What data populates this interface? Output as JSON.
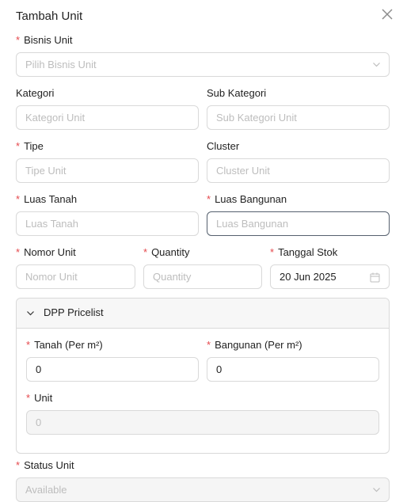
{
  "modal": {
    "title": "Tambah Unit"
  },
  "fields": {
    "bisnis_unit": {
      "label": "Bisnis Unit",
      "placeholder": "Pilih Bisnis Unit"
    },
    "kategori": {
      "label": "Kategori",
      "placeholder": "Kategori Unit"
    },
    "sub_kategori": {
      "label": "Sub Kategori",
      "placeholder": "Sub Kategori Unit"
    },
    "tipe": {
      "label": "Tipe",
      "placeholder": "Tipe Unit"
    },
    "cluster": {
      "label": "Cluster",
      "placeholder": "Cluster Unit"
    },
    "luas_tanah": {
      "label": "Luas Tanah",
      "placeholder": "Luas Tanah"
    },
    "luas_bangunan": {
      "label": "Luas Bangunan",
      "placeholder": "Luas Bangunan"
    },
    "nomor_unit": {
      "label": "Nomor Unit",
      "placeholder": "Nomor Unit"
    },
    "quantity": {
      "label": "Quantity",
      "placeholder": "Quantity"
    },
    "tanggal_stok": {
      "label": "Tanggal Stok",
      "value": "20 Jun 2025"
    },
    "status_unit": {
      "label": "Status Unit",
      "value": "Available"
    }
  },
  "dpp_panel": {
    "title": "DPP Pricelist",
    "tanah": {
      "label": "Tanah (Per m²)",
      "value": "0"
    },
    "bangunan": {
      "label": "Bangunan (Per m²)",
      "value": "0"
    },
    "unit": {
      "label": "Unit",
      "value": "0"
    }
  },
  "colors": {
    "required": "#e5484d",
    "border": "#d9d9d9",
    "focus_border": "#55606e",
    "placeholder": "#bdbdbd"
  },
  "icons": {
    "close": "close-icon",
    "select": "chevron-down-icon",
    "panel_toggle": "chevron-down-icon",
    "date": "calendar-icon"
  }
}
